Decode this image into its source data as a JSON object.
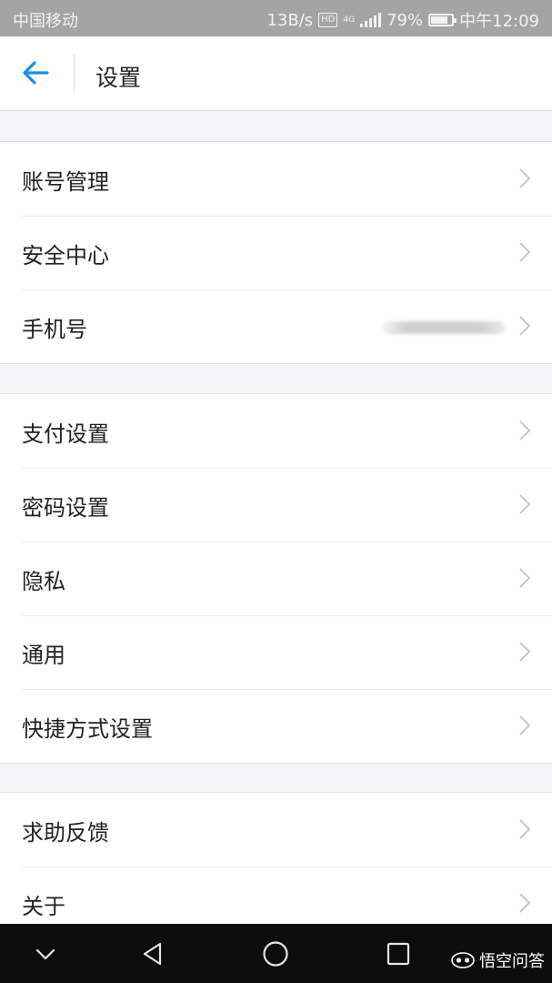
{
  "status_bar": {
    "carrier": "中国移动",
    "speed": "13B/s",
    "hd": "HD",
    "network": "4G",
    "battery": "79%",
    "battery_level": 0.79,
    "time": "中午12:09"
  },
  "header": {
    "title": "设置",
    "back_icon": "arrow-left-icon"
  },
  "groups": [
    {
      "items": [
        {
          "label": "账号管理"
        },
        {
          "label": "安全中心"
        },
        {
          "label": "手机号",
          "value_blurred": true
        }
      ]
    },
    {
      "items": [
        {
          "label": "支付设置"
        },
        {
          "label": "密码设置"
        },
        {
          "label": "隐私"
        },
        {
          "label": "通用"
        },
        {
          "label": "快捷方式设置"
        }
      ]
    },
    {
      "items": [
        {
          "label": "求助反馈"
        },
        {
          "label": "关于"
        }
      ]
    }
  ],
  "navbar": {
    "buttons": [
      "chevron-down-icon",
      "back-triangle-icon",
      "home-circle-icon",
      "recents-square-icon"
    ],
    "watermark": "悟空问答"
  },
  "colors": {
    "accent": "#1a8ee6",
    "status_bar": "#a4a4a4",
    "background": "#f5f5f9",
    "chevron": "#c7c7cc"
  }
}
